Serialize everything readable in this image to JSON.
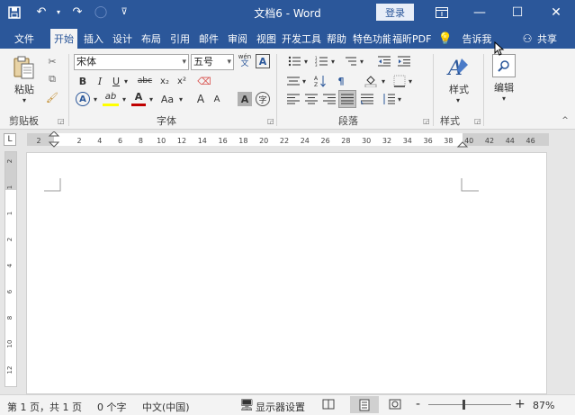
{
  "titlebar": {
    "doc_title": "文档6  -  Word",
    "login_label": "登录"
  },
  "tabs": [
    {
      "label": "文件"
    },
    {
      "label": "开始",
      "active": true
    },
    {
      "label": "插入"
    },
    {
      "label": "设计"
    },
    {
      "label": "布局"
    },
    {
      "label": "引用"
    },
    {
      "label": "邮件"
    },
    {
      "label": "审阅"
    },
    {
      "label": "视图"
    },
    {
      "label": "开发工具"
    },
    {
      "label": "帮助"
    },
    {
      "label": "特色功能"
    },
    {
      "label": "福昕PDF"
    },
    {
      "label": "告诉我"
    },
    {
      "label": "共享"
    }
  ],
  "ribbon": {
    "clipboard": {
      "paste_label": "粘贴",
      "group_label": "剪贴板"
    },
    "font": {
      "font_name": "宋体",
      "font_size": "五号",
      "phonetic_label": "wén",
      "char_border_label": "A",
      "bold": "B",
      "italic": "I",
      "underline": "U",
      "strike": "abc",
      "subscript": "x₂",
      "superscript": "x²",
      "text_effects": "A",
      "highlight": "ab",
      "font_color": "A",
      "change_case": "Aa",
      "grow": "A",
      "shrink": "A",
      "char_shading": "A",
      "enclose": "字",
      "group_label": "字体"
    },
    "paragraph": {
      "group_label": "段落"
    },
    "styles": {
      "styles_label": "样式",
      "group_label": "样式"
    },
    "editing": {
      "editing_label": "编辑"
    }
  },
  "ruler": {
    "ticks": [
      "2",
      "2",
      "4",
      "6",
      "8",
      "10",
      "12",
      "14",
      "16",
      "18",
      "20",
      "22",
      "24",
      "26",
      "28",
      "30",
      "32",
      "34",
      "36",
      "38",
      "40",
      "42",
      "44",
      "46"
    ],
    "vticks": [
      "2",
      "1",
      "1",
      "2",
      "4",
      "6",
      "8",
      "10",
      "12"
    ]
  },
  "status": {
    "page": "第 1 页，共 1 页",
    "words": "0 个字",
    "language": "中文(中国)",
    "display_settings": "显示器设置",
    "zoom_minus": "-",
    "zoom_plus": "+",
    "zoom": "87%"
  },
  "colors": {
    "accent": "#2b579a",
    "highlight": "#ffff00",
    "font_color": "#c00000"
  }
}
